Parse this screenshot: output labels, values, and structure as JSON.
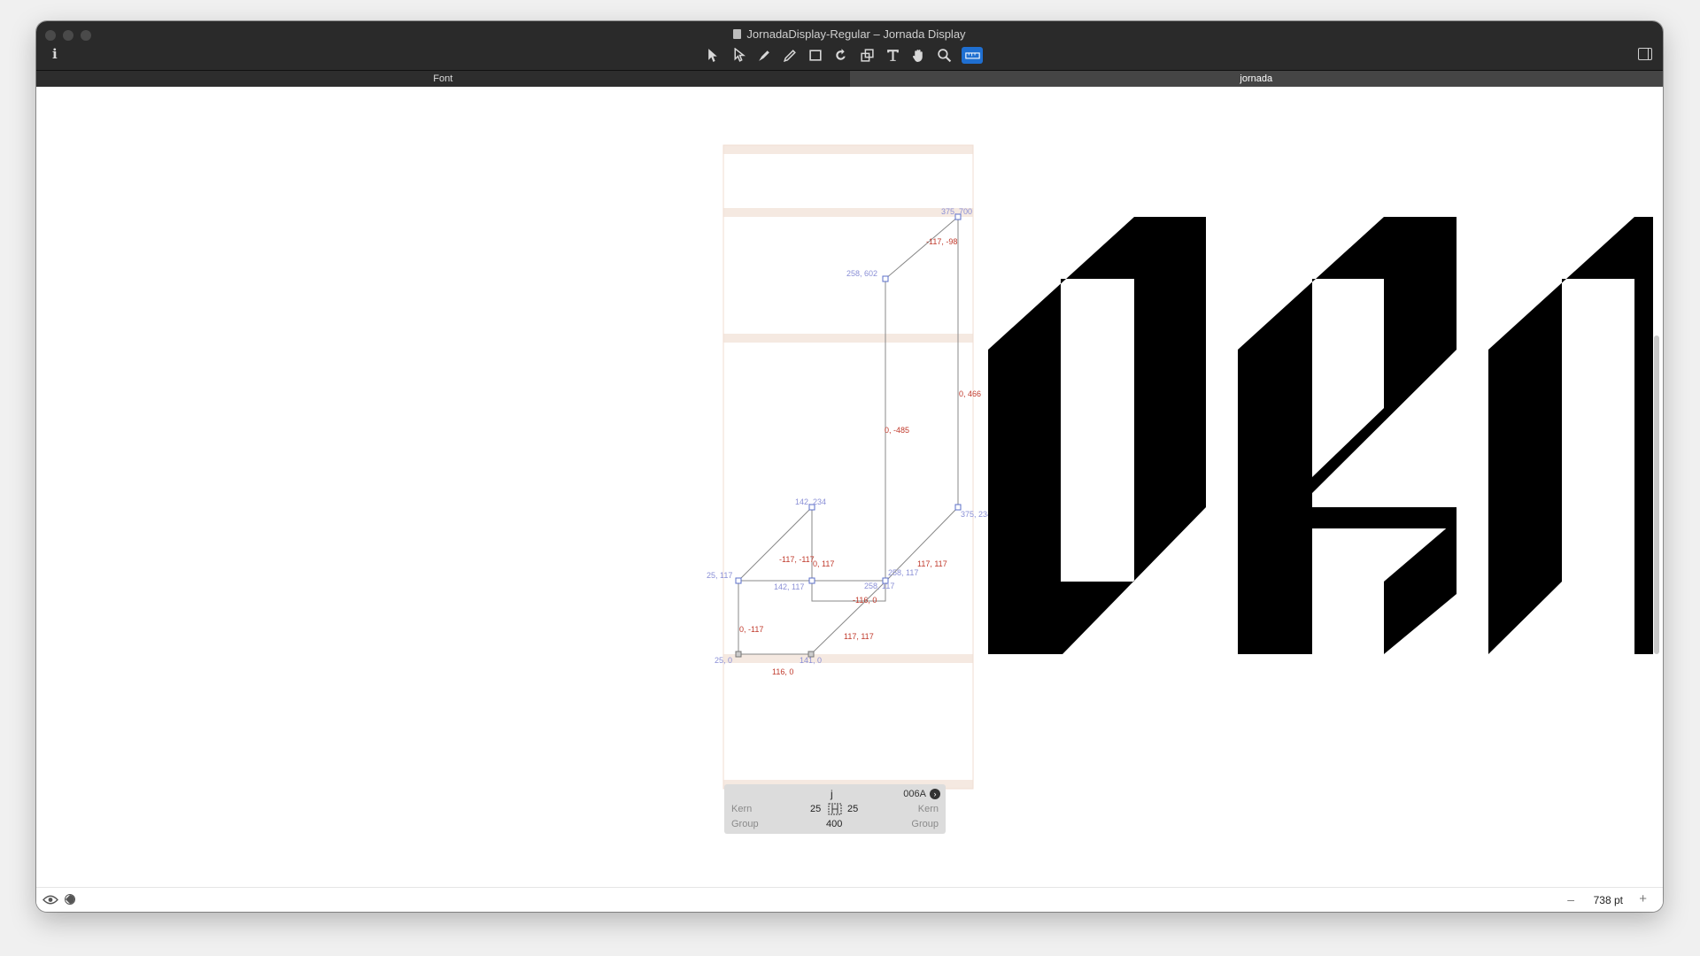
{
  "window": {
    "title": "JornadaDisplay-Regular – Jornada Display"
  },
  "tabs": [
    {
      "label": "Font"
    },
    {
      "label": "jornada"
    }
  ],
  "tools": [
    "select-icon",
    "select-all-layers-icon",
    "pen-icon",
    "pencil-icon",
    "primitives-icon",
    "rotate-icon",
    "scale-icon",
    "text-icon",
    "hand-icon",
    "zoom-icon",
    "measurement-icon"
  ],
  "glyph": {
    "nodes": [
      {
        "label": "375, 700"
      },
      {
        "label": "258, 602"
      },
      {
        "label": "375, 234"
      },
      {
        "label": "142, 234"
      },
      {
        "label": "25, 117"
      },
      {
        "label": "142, 117"
      },
      {
        "label": "258, 117"
      },
      {
        "label": "258, 117"
      },
      {
        "label": "25, 0"
      },
      {
        "label": "141, 0"
      }
    ],
    "segments": [
      {
        "label": "-117, -98"
      },
      {
        "label": "0, 466"
      },
      {
        "label": "0, -485"
      },
      {
        "label": "-117, -117"
      },
      {
        "label": "0, 117"
      },
      {
        "label": "117, 117"
      },
      {
        "label": "-116, 0"
      },
      {
        "label": "0, -117"
      },
      {
        "label": "117, 117"
      },
      {
        "label": "116, 0"
      }
    ]
  },
  "info_panel": {
    "glyph_char": "j",
    "unicode": "006A",
    "lsb": "25",
    "rsb": "25",
    "width": "400",
    "kern_left": "Kern",
    "kern_right": "Kern",
    "group_left": "Group",
    "group_right": "Group"
  },
  "bottom": {
    "zoom": "738 pt",
    "minus": "–",
    "plus": "+"
  },
  "colors": {
    "node_label": "#8a8fd6",
    "segment_label": "#c0392b",
    "metric_band": "#f5e9e1",
    "accent": "#1f6fd1"
  }
}
